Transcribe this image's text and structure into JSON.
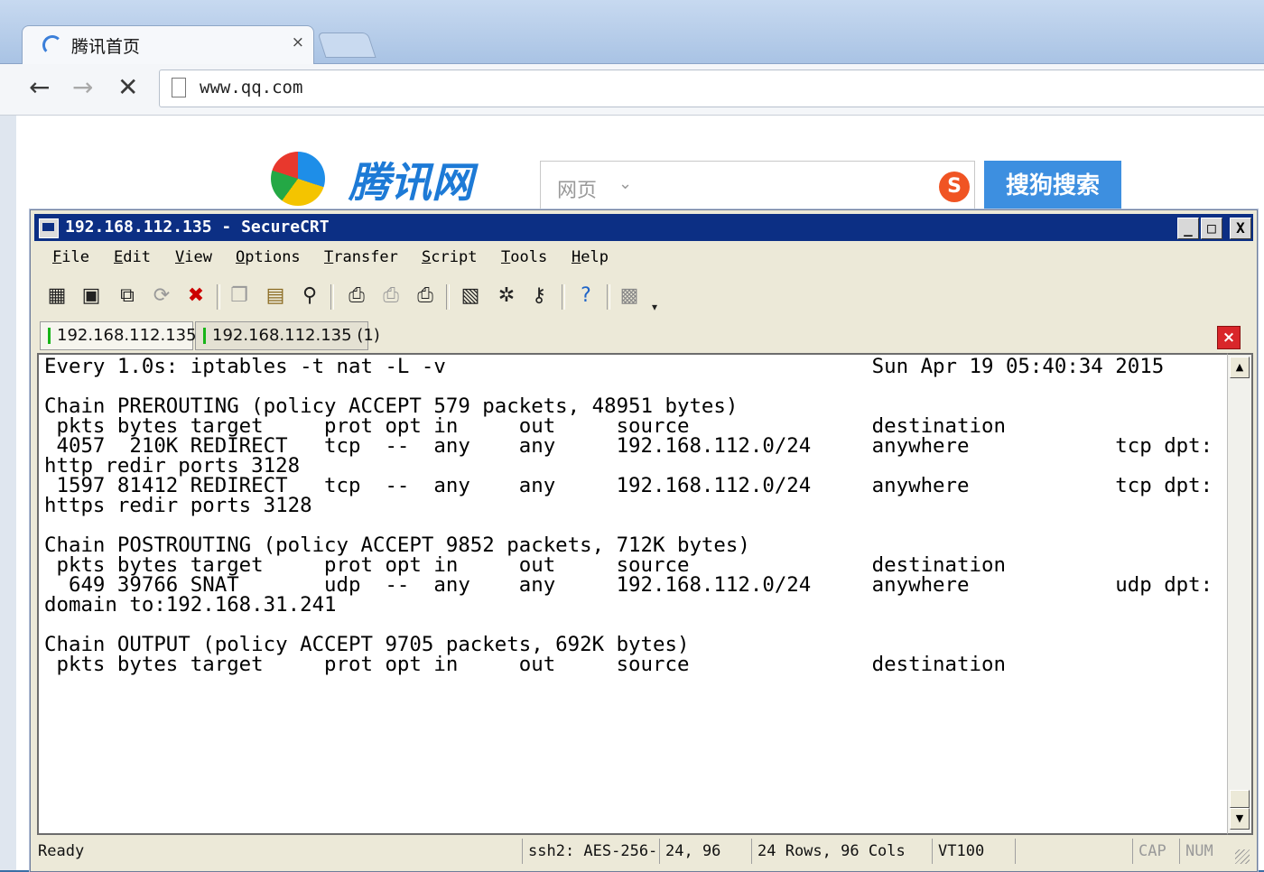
{
  "browser": {
    "tab_title": "腾讯首页",
    "tab_close": "×",
    "url": "www.qq.com",
    "nav": {
      "back": "←",
      "forward": "→",
      "stop": "✕"
    },
    "page": {
      "logo_text": "腾讯网",
      "search_category": "网页",
      "search_arrow": "⌄",
      "sogou_glyph": "S",
      "search_button": "搜狗搜索"
    }
  },
  "crt": {
    "title": "192.168.112.135 - SecureCRT",
    "window_buttons": {
      "minimize": "_",
      "maximize": "□",
      "close": "X"
    },
    "menu": [
      "File",
      "Edit",
      "View",
      "Options",
      "Transfer",
      "Script",
      "Tools",
      "Help"
    ],
    "toolbar_icons": [
      "connect-icon",
      "quick-connect-icon",
      "connect-in-tab-icon",
      "reconnect-icon",
      "disconnect-icon",
      "copy-icon",
      "paste-icon",
      "find-icon",
      "print-screen-icon",
      "print-selection-icon",
      "print-icon",
      "session-options-icon",
      "global-options-icon",
      "keymap-icon",
      "help-icon",
      "sftp-icon"
    ],
    "tabs": [
      {
        "label": "192.168.112.135",
        "active": true
      },
      {
        "label": "192.168.112.135 (1)",
        "active": false
      }
    ],
    "tab_close": "×",
    "terminal_lines": [
      "Every 1.0s: iptables -t nat -L -v                                   Sun Apr 19 05:40:34 2015",
      "",
      "Chain PREROUTING (policy ACCEPT 579 packets, 48951 bytes)",
      " pkts bytes target     prot opt in     out     source               destination",
      " 4057  210K REDIRECT   tcp  --  any    any     192.168.112.0/24     anywhere            tcp dpt:",
      "http redir ports 3128",
      " 1597 81412 REDIRECT   tcp  --  any    any     192.168.112.0/24     anywhere            tcp dpt:",
      "https redir ports 3128",
      "",
      "Chain POSTROUTING (policy ACCEPT 9852 packets, 712K bytes)",
      " pkts bytes target     prot opt in     out     source               destination",
      "  649 39766 SNAT       udp  --  any    any     192.168.112.0/24     anywhere            udp dpt:",
      "domain to:192.168.31.241",
      "",
      "Chain OUTPUT (policy ACCEPT 9705 packets, 692K bytes)",
      " pkts bytes target     prot opt in     out     source               destination"
    ],
    "scroll_up": "▲",
    "scroll_down": "▼",
    "status": {
      "ready": "Ready",
      "cipher": "ssh2: AES-256-",
      "cursor": "24,  96",
      "size": "24 Rows,  96 Cols",
      "emulation": "VT100",
      "cap": "CAP",
      "num": "NUM"
    }
  }
}
